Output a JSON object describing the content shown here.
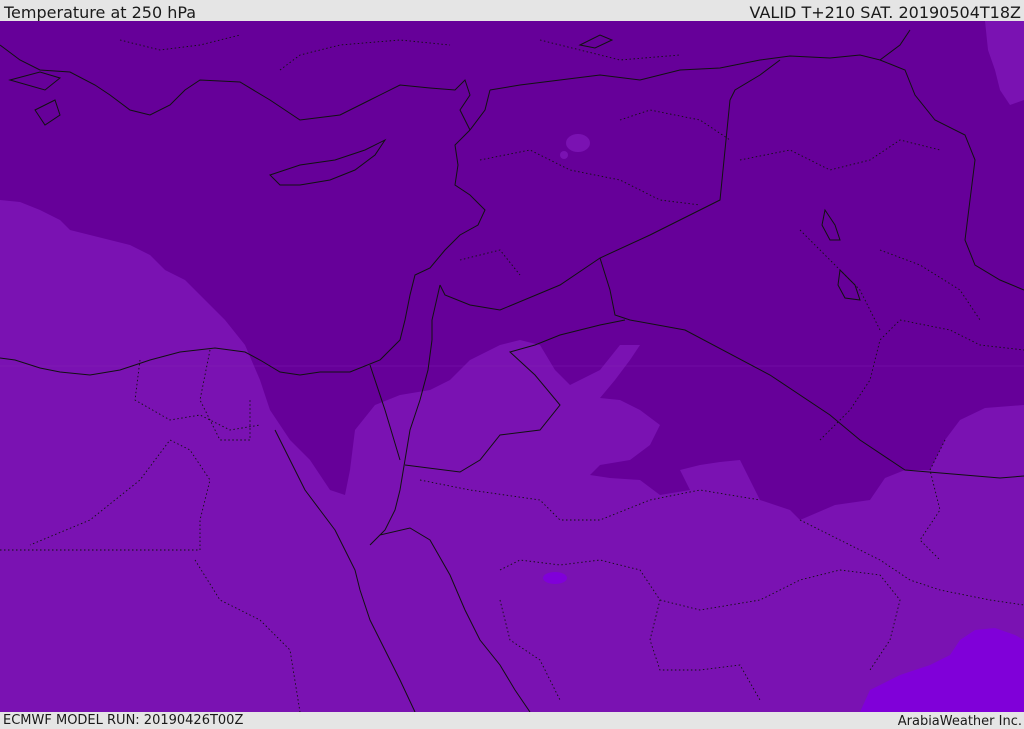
{
  "header": {
    "title": "Temperature at 250 hPa",
    "valid": "VALID T+210 SAT. 20190504T18Z"
  },
  "footer": {
    "model_run": "ECMWF MODEL RUN: 20190426T00Z",
    "credit": "ArabiaWeather Inc."
  },
  "colors": {
    "background_band": "#e5e5e5",
    "cold_band": "#660099",
    "mid_band": "#7a12b2",
    "warm_band": "#8000d9",
    "boundaries": "#111111"
  }
}
